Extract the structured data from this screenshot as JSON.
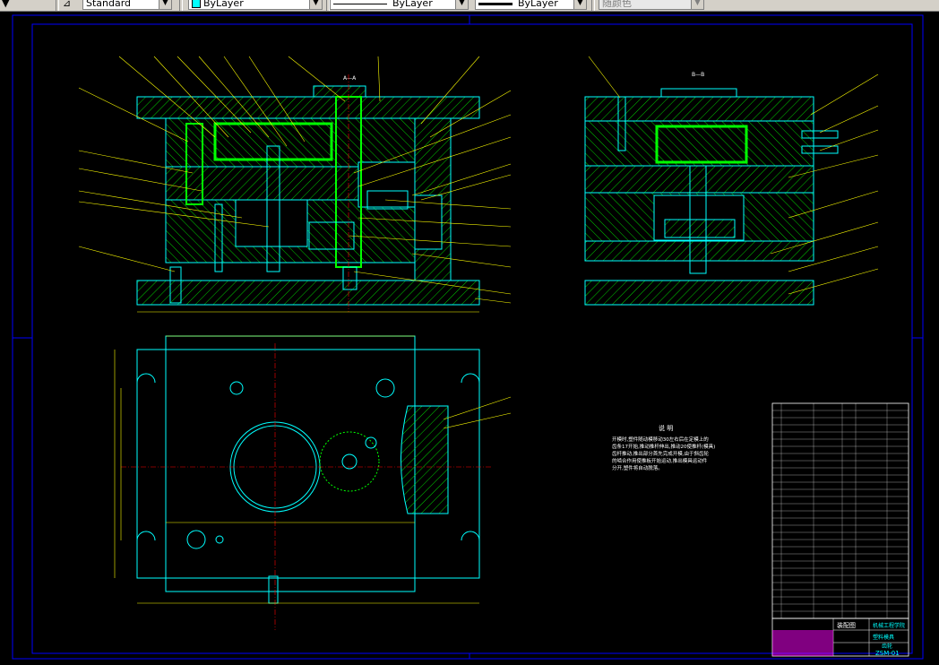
{
  "toolbar": {
    "text_style": "Standard",
    "layer_color_label": "ByLayer",
    "linetype_label": "ByLayer",
    "lineweight_label": "ByLayer",
    "plot_style_label": "随颜色",
    "layer_color_hex": "#00ffff"
  },
  "drawing": {
    "section_label_aa": "A—A",
    "section_label_bb": "B—B",
    "notes_title": "说  明",
    "notes_lines": [
      "开模时,塑件随动模移动30左右后在定模上的",
      "齿条17开始,推动推杆伸出,推动20使推杆(模具)",
      "齿杆推动,推出部分首先完成开模,由于斜齿轮",
      "的啮合作用使推板开始运动,推出模具运动件",
      "分开,塑件将自动脱落。"
    ]
  },
  "title_block": {
    "school": "机械工程学院",
    "drawing_name": "装配图",
    "part_name": "塑料模具",
    "part_sub": "齿轮",
    "drawing_no": "ZSM-01"
  },
  "colors": {
    "background": "#000000",
    "frame": "#0000ff",
    "outline": "#00ffff",
    "hatch": "#00ff00",
    "leader": "#ffff00",
    "dimension": "#ffff00",
    "annotation": "#ffffff",
    "magenta": "#ff00ff"
  }
}
